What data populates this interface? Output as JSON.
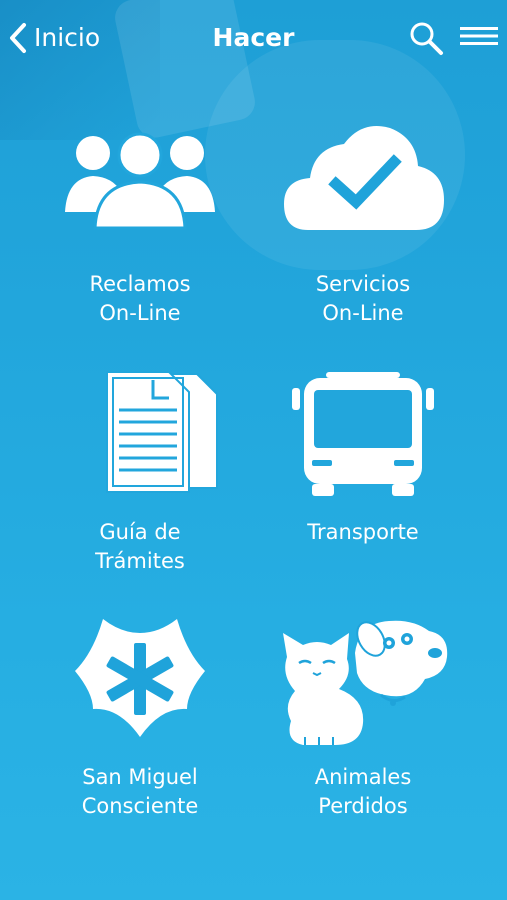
{
  "nav": {
    "back_label": "Inicio",
    "title": "Hacer",
    "search_icon": "search-icon",
    "menu_icon": "menu-icon"
  },
  "tiles": [
    {
      "line1": "Reclamos",
      "line2": "On-Line",
      "icon": "users-icon"
    },
    {
      "line1": "Servicios",
      "line2": "On-Line",
      "icon": "cloud-check-icon"
    },
    {
      "line1": "Guía de",
      "line2": "Trámites",
      "icon": "documents-icon"
    },
    {
      "line1": "Transporte",
      "line2": "",
      "icon": "bus-icon"
    },
    {
      "line1": "San Miguel",
      "line2": "Consciente",
      "icon": "star-asterisk-icon"
    },
    {
      "line1": "Animales",
      "line2": "Perdidos",
      "icon": "pets-icon"
    }
  ],
  "colors": {
    "background_top": "#1e9fd6",
    "background_bottom": "#2bb3e5",
    "foreground": "#ffffff"
  }
}
